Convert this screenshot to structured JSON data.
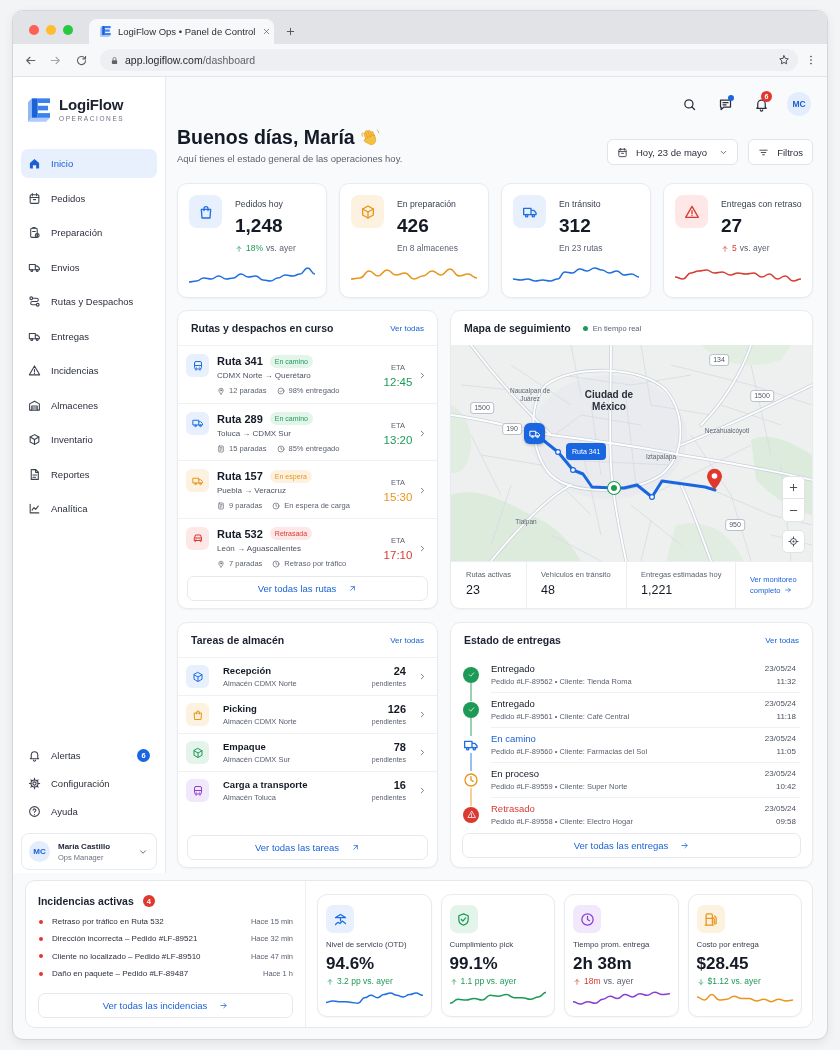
{
  "browser": {
    "tab_title": "LogiFlow Ops • Panel de Control",
    "url_host": "app.logiflow.com",
    "url_path": "/dashboard"
  },
  "sidebar": {
    "brand": "LogiFlow",
    "tagline": "OPERACIONES",
    "nav": [
      {
        "label": "Inicio",
        "selected": true
      },
      {
        "label": "Pedidos",
        "selected": false
      },
      {
        "label": "Preparación",
        "selected": false
      },
      {
        "label": "Envios",
        "selected": false
      },
      {
        "label": "Rutas y Despachos",
        "selected": false
      },
      {
        "label": "Entregas",
        "selected": false
      },
      {
        "label": "Incidencias",
        "selected": false
      },
      {
        "label": "Almacenes",
        "selected": false
      },
      {
        "label": "Inventario",
        "selected": false
      },
      {
        "label": "Reportes",
        "selected": false
      },
      {
        "label": "Analítica",
        "selected": false
      }
    ],
    "footer_nav": [
      {
        "label": "Alertas",
        "badge": "6"
      },
      {
        "label": "Configuración"
      },
      {
        "label": "Ayuda"
      }
    ],
    "user": {
      "initials": "MC",
      "name": "María Castillo",
      "role": "Ops Manager"
    }
  },
  "header": {
    "messages_unread": true,
    "notifications_badge": "6",
    "avatar_initials": "MC"
  },
  "greeting": {
    "title": "Buenos días, María",
    "subtitle": "Aquí tienes el estado general de las operaciones hoy.",
    "date_button": "Hoy, 23 de mayo",
    "filter_button": "Filtros"
  },
  "stats": [
    {
      "kind": "orders",
      "label": "Pedidos hoy",
      "value": "1,248",
      "change": {
        "rising": true,
        "positive": true,
        "value": "18%",
        "rest": "vs. ayer"
      }
    },
    {
      "kind": "preparation",
      "label": "En preparación",
      "value": "426",
      "note": "En 8 almacenes"
    },
    {
      "kind": "transit",
      "label": "En tránsito",
      "value": "312",
      "note": "En 23 rutas"
    },
    {
      "kind": "delays",
      "label": "Entregas con retraso",
      "value": "27",
      "change": {
        "rising": true,
        "positive": false,
        "value": "5",
        "rest": "vs. ayer"
      }
    }
  ],
  "routes": {
    "title": "Rutas y despachos en curso",
    "link": "Ver todas",
    "items": [
      {
        "kind": "moving",
        "name": "Ruta 341",
        "status_label": "En camino",
        "path": "CDMX Norte → Querétaro",
        "stops": "12 paradas",
        "detail": "98% entregado",
        "eta_label": "ETA",
        "eta": "12:45"
      },
      {
        "kind": "moving",
        "name": "Ruta 289",
        "status_label": "En camino",
        "path": "Toluca → CDMX Sur",
        "stops": "15 paradas",
        "detail": "85% entregado",
        "eta_label": "ETA",
        "eta": "13:20"
      },
      {
        "kind": "waiting",
        "name": "Ruta 157",
        "status_label": "En espera",
        "path": "Puebla → Veracruz",
        "stops": "9 paradas",
        "detail": "En espera de carga",
        "eta_label": "ETA",
        "eta": "15:30"
      },
      {
        "kind": "delayed",
        "name": "Ruta 532",
        "status_label": "Retrasada",
        "path": "León → Aguascalientes",
        "stops": "7 paradas",
        "detail": "Retraso por tráfico",
        "eta_label": "ETA",
        "eta": "17:10"
      }
    ],
    "button": "Ver todas las rutas"
  },
  "map": {
    "title": "Mapa de seguimiento",
    "live_label": "En tiempo real",
    "places": [
      {
        "name": "Naucalpan de Juárez",
        "kind": "district"
      },
      {
        "name": "Ciudad de México",
        "kind": "city"
      },
      {
        "name": "Nezahualcóyotl",
        "kind": "district"
      },
      {
        "name": "Iztapalapa",
        "kind": "district"
      },
      {
        "name": "Tlalpan",
        "kind": "district"
      }
    ],
    "road_signs": [
      "1500",
      "134",
      "190",
      "1500",
      "950"
    ],
    "route_label": "Ruta 341",
    "stats": [
      {
        "label": "Rutas activas",
        "value": "23"
      },
      {
        "label": "Vehículos en tránsito",
        "value": "48"
      },
      {
        "label": "Entregas estimadas hoy",
        "value": "1,221"
      }
    ],
    "link": "Ver monitoreo completo"
  },
  "tasks": {
    "title": "Tareas de almacén",
    "link": "Ver todas",
    "items": [
      {
        "kind": "receiving",
        "name": "Recepción",
        "warehouse": "Almacén CDMX Norte",
        "count": "24",
        "count_label": "pendientes"
      },
      {
        "kind": "picking",
        "name": "Picking",
        "warehouse": "Almacén CDMX Norte",
        "count": "126",
        "count_label": "pendientes"
      },
      {
        "kind": "packing",
        "name": "Empaque",
        "warehouse": "Almacén CDMX Sur",
        "count": "78",
        "count_label": "pendientes"
      },
      {
        "kind": "loading",
        "name": "Carga a transporte",
        "warehouse": "Almacén Toluca",
        "count": "16",
        "count_label": "pendientes"
      }
    ],
    "button": "Ver todas las tareas"
  },
  "deliveries": {
    "title": "Estado de entregas",
    "link": "Ver todas",
    "items": [
      {
        "kind": "delivered",
        "title": "Entregado",
        "detail": "Pedido #LF-89562 • Cliente: Tienda Roma",
        "date": "23/05/24",
        "time": "11:32"
      },
      {
        "kind": "delivered",
        "title": "Entregado",
        "detail": "Pedido #LF-89561 • Cliente: Café Central",
        "date": "23/05/24",
        "time": "11:18"
      },
      {
        "kind": "moving",
        "title": "En camino",
        "detail": "Pedido #LF-89560 • Cliente: Farmacias del Sol",
        "date": "23/05/24",
        "time": "11:05"
      },
      {
        "kind": "processing",
        "title": "En proceso",
        "detail": "Pedido #LF-89559 • Cliente: Super Norte",
        "date": "23/05/24",
        "time": "10:42"
      },
      {
        "kind": "delayed",
        "title": "Retrasado",
        "detail": "Pedido #LF-89558 • Cliente: Electro Hogar",
        "date": "23/05/24",
        "time": "09:58"
      }
    ],
    "button": "Ver todas las entregas"
  },
  "incidents": {
    "title": "Incidencias activas",
    "count": "4",
    "items": [
      {
        "text": "Retraso por tráfico en Ruta 532",
        "time": "Hace 15 min"
      },
      {
        "text": "Dirección incorrecta – Pedido #LF-89521",
        "time": "Hace 32 min"
      },
      {
        "text": "Cliente no localizado – Pedido #LF-89510",
        "time": "Hace 47 min"
      },
      {
        "text": "Daño en paquete – Pedido #LF-89487",
        "time": "Hace 1 h"
      }
    ],
    "button": "Ver todas las incidencias"
  },
  "kpis": [
    {
      "kind": "service_level",
      "label": "Nivel de servicio (OTD)",
      "value": "94.6%",
      "change": {
        "rising": true,
        "positive": true,
        "value": "3.2 pp vs. ayer"
      }
    },
    {
      "kind": "picking",
      "label": "Cumplimiento pick",
      "value": "99.1%",
      "change": {
        "rising": true,
        "positive": true,
        "value": "1.1 pp vs. ayer"
      }
    },
    {
      "kind": "delivery_time",
      "label": "Tiempo prom. entrega",
      "value": "2h 38m",
      "change": {
        "rising": true,
        "positive": false,
        "value": "18m",
        "rest": "vs. ayer"
      }
    },
    {
      "kind": "cost",
      "label": "Costo por entrega",
      "value": "$28.45",
      "change": {
        "rising": false,
        "positive": true,
        "value": "$1.12 vs. ayer"
      }
    }
  ]
}
